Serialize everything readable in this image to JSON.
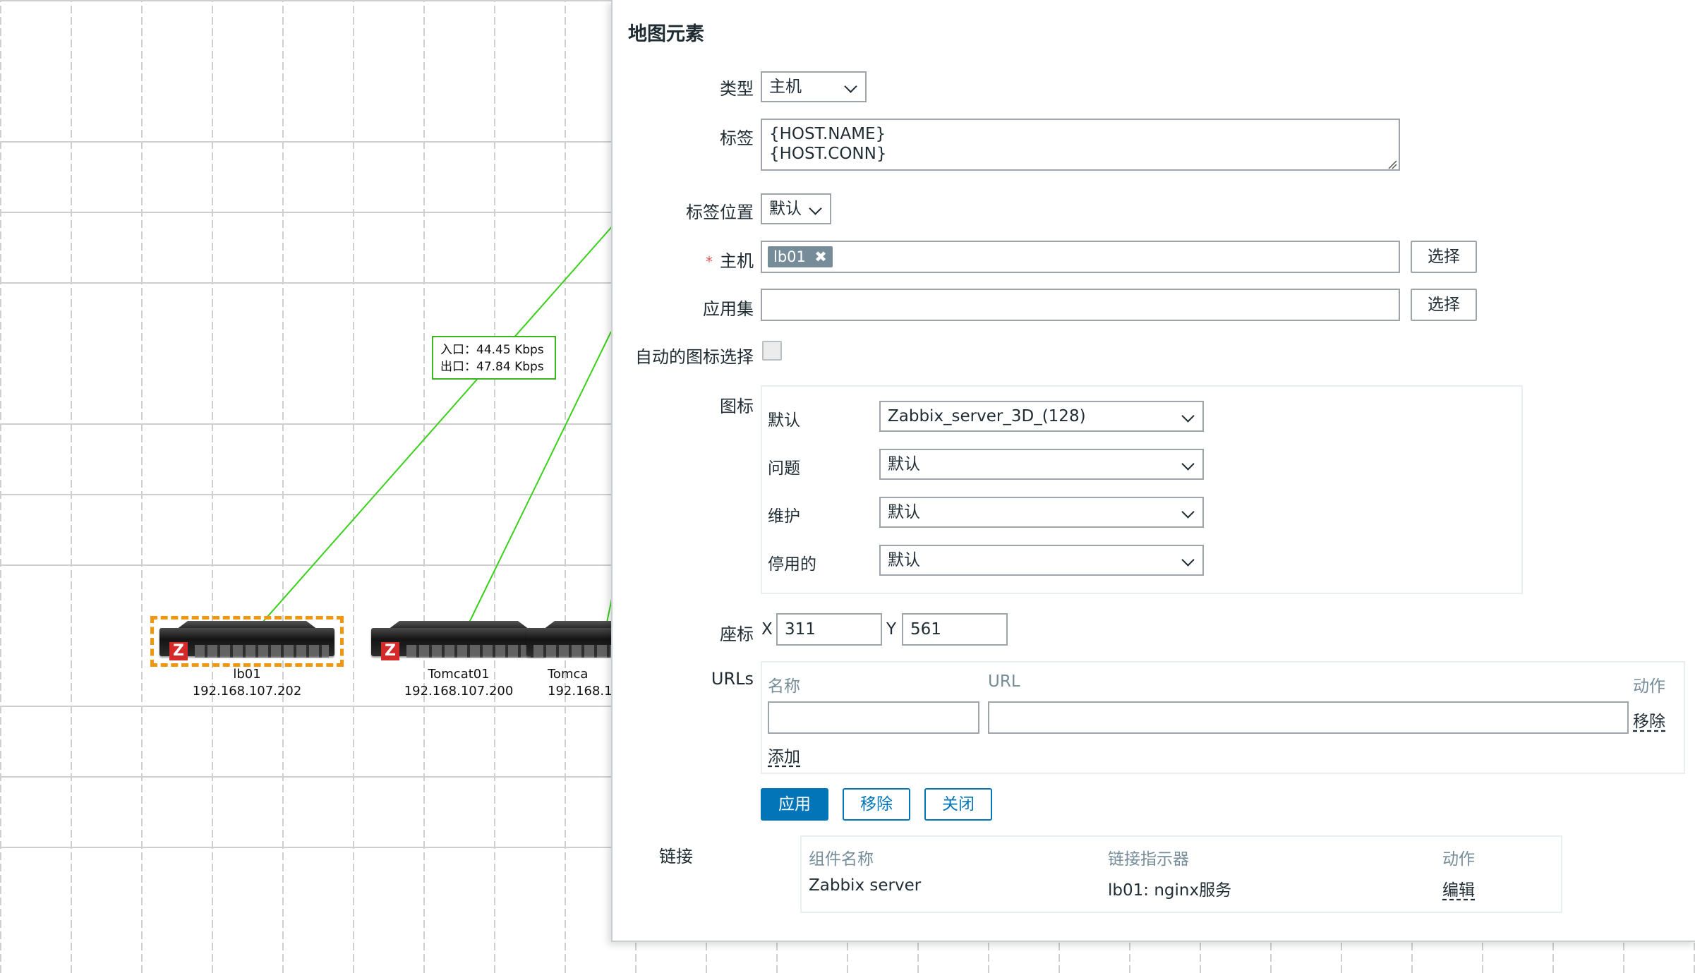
{
  "map": {
    "link_label": {
      "in": "入口：44.45 Kbps",
      "out": "出口：47.84 Kbps"
    },
    "hosts": [
      {
        "name": "lb01",
        "ip": "192.168.107.202",
        "selected": true
      },
      {
        "name": "Tomcat01",
        "ip": "192.168.107.200",
        "selected": false
      },
      {
        "name": "Tomca",
        "ip": "192.168.1",
        "selected": false
      }
    ],
    "link_color": "#3ad11a",
    "selection_color": "#f0960f"
  },
  "dialog": {
    "title": "地图元素",
    "type": {
      "label": "类型",
      "value": "主机"
    },
    "label": {
      "label": "标签",
      "value": "{HOST.NAME}\n{HOST.CONN}"
    },
    "label_position": {
      "label": "标签位置",
      "value": "默认"
    },
    "host": {
      "label": "主机",
      "required_mark": "*",
      "tag": "lb01",
      "tag_remove": "✖",
      "select_button": "选择"
    },
    "application": {
      "label": "应用集",
      "value": "",
      "select_button": "选择"
    },
    "auto_icon": {
      "label": "自动的图标选择",
      "checked": false
    },
    "icons": {
      "label": "图标",
      "rows": [
        {
          "label": "默认",
          "value": "Zabbix_server_3D_(128)"
        },
        {
          "label": "问题",
          "value": "默认"
        },
        {
          "label": "维护",
          "value": "默认"
        },
        {
          "label": "停用的",
          "value": "默认"
        }
      ]
    },
    "coordinates": {
      "label": "座标",
      "x_label": "X",
      "x_value": "311",
      "y_label": "Y",
      "y_value": "561"
    },
    "urls": {
      "label": "URLs",
      "col_name": "名称",
      "col_url": "URL",
      "col_action": "动作",
      "row_name": "",
      "row_url": "",
      "remove_link": "移除",
      "add_link": "添加"
    },
    "buttons": {
      "apply": "应用",
      "remove": "移除",
      "close": "关闭"
    },
    "links": {
      "label": "链接",
      "col_element": "组件名称",
      "col_indicator": "链接指示器",
      "col_action": "动作",
      "rows": [
        {
          "element": "Zabbix server",
          "indicator": "lb01: nginx服务",
          "action": "编辑"
        }
      ]
    },
    "accent_color": "#0275b8"
  }
}
